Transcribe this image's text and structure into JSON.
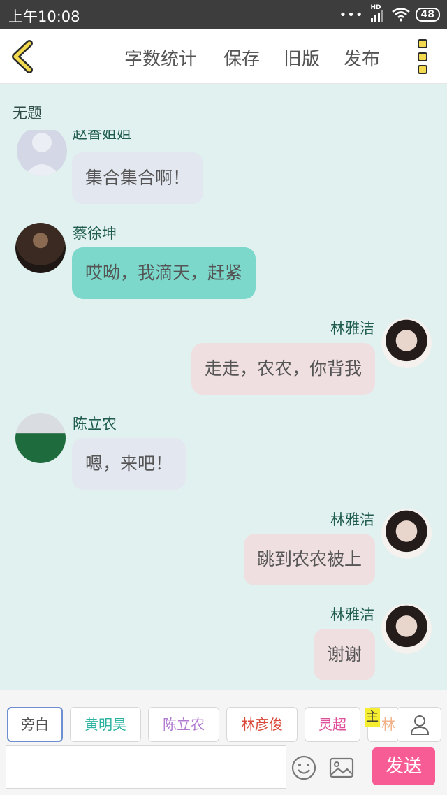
{
  "status_bar": {
    "time": "上午10:08",
    "signal_label": "HD",
    "battery": "48"
  },
  "toolbar": {
    "word_count": "字数统计",
    "save": "保存",
    "old_version": "旧版",
    "publish": "发布"
  },
  "doc_title": "无题",
  "messages": [
    {
      "sender": "赵香姐姐",
      "text": "集合集合啊！",
      "side": "left",
      "style": "gray"
    },
    {
      "sender": "蔡徐坤",
      "text": "哎呦，我滴天，赶紧",
      "side": "left",
      "style": "teal"
    },
    {
      "sender": "林雅洁",
      "text": "走走，农农，你背我",
      "side": "right",
      "style": "pink"
    },
    {
      "sender": "陈立农",
      "text": "嗯，来吧！",
      "side": "left",
      "style": "gray"
    },
    {
      "sender": "林雅洁",
      "text": "跳到农农被上",
      "side": "right",
      "style": "pink"
    },
    {
      "sender": "林雅洁",
      "text": "谢谢",
      "side": "right",
      "style": "pink"
    }
  ],
  "characters": [
    {
      "name": "旁白",
      "color": "#555555"
    },
    {
      "name": "黄明昊",
      "color": "#2bb3a0"
    },
    {
      "name": "陈立农",
      "color": "#b07ad0"
    },
    {
      "name": "林彦俊",
      "color": "#d94a3a"
    },
    {
      "name": "灵超",
      "color": "#e0509a"
    },
    {
      "name": "林",
      "color": "#f2b28a"
    }
  ],
  "main_tag": "主",
  "composer": {
    "input_value": "",
    "send_label": "发送"
  },
  "icons": {
    "back": "chevron-left-icon",
    "more": "more-icon",
    "emoji": "smiley-icon",
    "image": "image-icon",
    "person": "person-icon"
  }
}
